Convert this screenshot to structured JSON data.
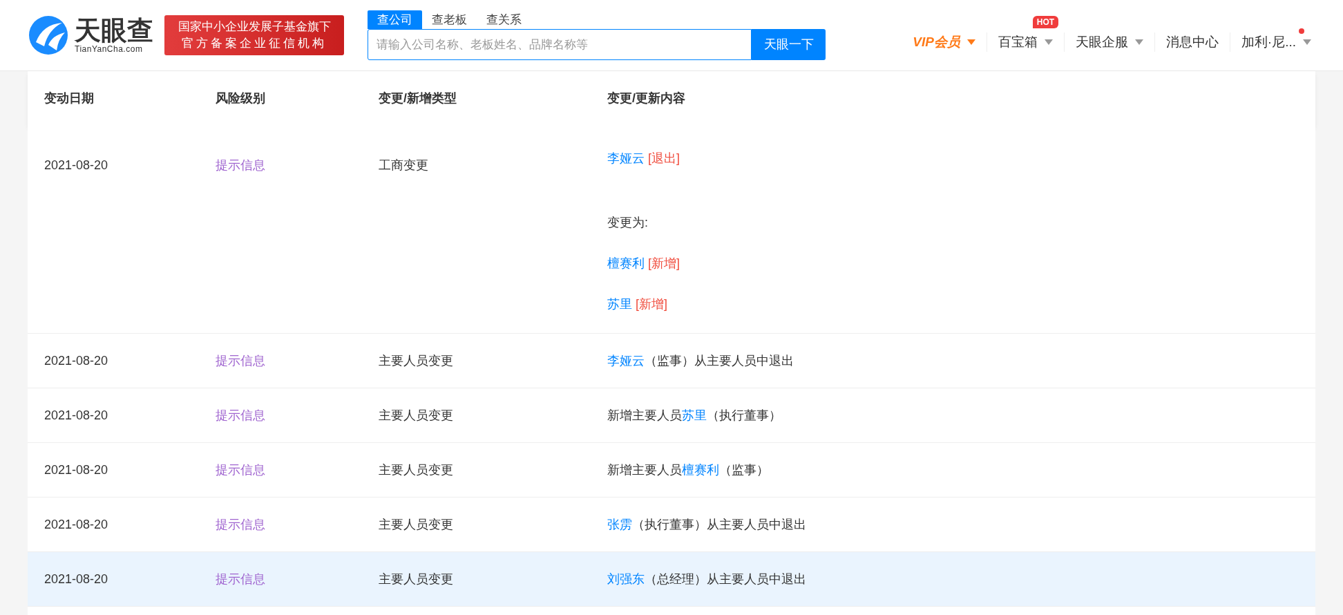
{
  "header": {
    "logo_text": "天眼查",
    "logo_sub": "TianYanCha.com",
    "badge_lines": [
      "国家中小企业发展子基金旗下",
      "官方备案企业征信机构"
    ],
    "search_tabs": [
      {
        "label": "查公司",
        "selected": true
      },
      {
        "label": "查老板",
        "selected": false
      },
      {
        "label": "查关系",
        "selected": false
      }
    ],
    "search": {
      "placeholder": "请输入公司名称、老板姓名、品牌名称等",
      "button": "天眼一下"
    },
    "nav": [
      {
        "label": "VIP会员",
        "kind": "vip",
        "dropdown": true
      },
      {
        "label": "百宝箱",
        "kind": "plain",
        "dropdown": true,
        "badge": "HOT"
      },
      {
        "label": "天眼企服",
        "kind": "plain",
        "dropdown": true
      },
      {
        "label": "消息中心",
        "kind": "plain",
        "dropdown": false
      },
      {
        "label": "加利·尼...",
        "kind": "user",
        "dropdown": true,
        "dot": true
      }
    ]
  },
  "table": {
    "columns": [
      "变动日期",
      "风险级别",
      "变更/新增类型",
      "变更/更新内容"
    ],
    "rows": [
      {
        "date": "2021-08-20",
        "risk": "提示信息",
        "type": "工商变更",
        "selected": false,
        "lines": [
          {
            "kind": "item",
            "segments": [
              {
                "kind": "name",
                "text": "李娅云"
              },
              {
                "kind": "tag",
                "text": "[退出]"
              }
            ]
          },
          {
            "kind": "heading",
            "segments": [
              {
                "kind": "text",
                "text": "变更为:"
              }
            ]
          },
          {
            "kind": "item",
            "segments": [
              {
                "kind": "name",
                "text": "檀赛利"
              },
              {
                "kind": "tag",
                "text": "[新增]"
              }
            ]
          },
          {
            "kind": "item",
            "segments": [
              {
                "kind": "name",
                "text": "苏里"
              },
              {
                "kind": "tag",
                "text": "[新增]"
              }
            ]
          }
        ]
      },
      {
        "date": "2021-08-20",
        "risk": "提示信息",
        "type": "主要人员变更",
        "selected": false,
        "lines": [
          {
            "kind": "sentence",
            "segments": [
              {
                "kind": "name",
                "text": "李娅云"
              },
              {
                "kind": "text",
                "text": "（监事）从主要人员中退出"
              }
            ]
          }
        ]
      },
      {
        "date": "2021-08-20",
        "risk": "提示信息",
        "type": "主要人员变更",
        "selected": false,
        "lines": [
          {
            "kind": "sentence",
            "segments": [
              {
                "kind": "text",
                "text": "新增主要人员"
              },
              {
                "kind": "name",
                "text": "苏里"
              },
              {
                "kind": "text",
                "text": "（执行董事）"
              }
            ]
          }
        ]
      },
      {
        "date": "2021-08-20",
        "risk": "提示信息",
        "type": "主要人员变更",
        "selected": false,
        "lines": [
          {
            "kind": "sentence",
            "segments": [
              {
                "kind": "text",
                "text": "新增主要人员"
              },
              {
                "kind": "name",
                "text": "檀赛利"
              },
              {
                "kind": "text",
                "text": "（监事）"
              }
            ]
          }
        ]
      },
      {
        "date": "2021-08-20",
        "risk": "提示信息",
        "type": "主要人员变更",
        "selected": false,
        "lines": [
          {
            "kind": "sentence",
            "segments": [
              {
                "kind": "name",
                "text": "张雳"
              },
              {
                "kind": "text",
                "text": "（执行董事）从主要人员中退出"
              }
            ]
          }
        ]
      },
      {
        "date": "2021-08-20",
        "risk": "提示信息",
        "type": "主要人员变更",
        "selected": true,
        "lines": [
          {
            "kind": "sentence",
            "segments": [
              {
                "kind": "name",
                "text": "刘强东"
              },
              {
                "kind": "text",
                "text": "（总经理）从主要人员中退出"
              }
            ]
          }
        ]
      }
    ]
  }
}
